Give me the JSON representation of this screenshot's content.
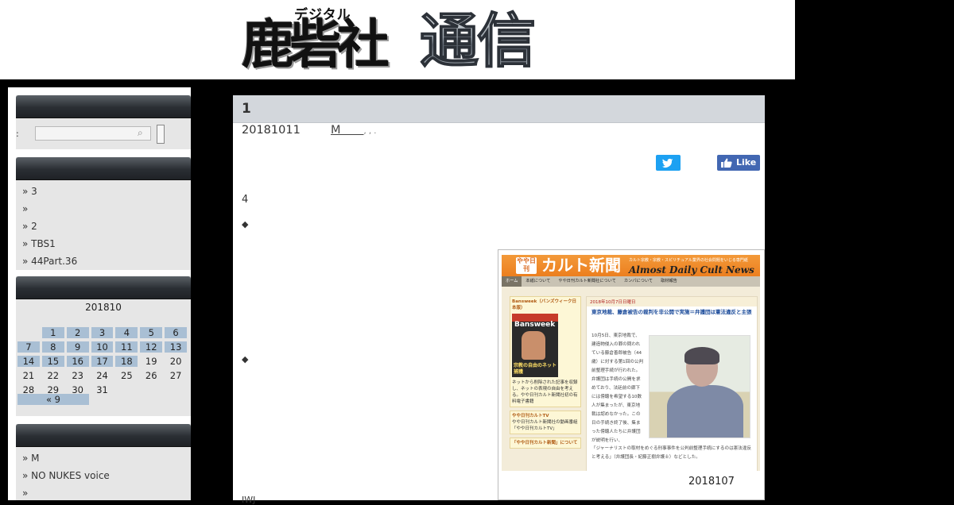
{
  "header": {
    "logo_ruby": "デジタル",
    "logo_brush": "鹿砦社",
    "logo_steel": "通信"
  },
  "sidebar": {
    "search": {
      "colon": ":",
      "placeholder": ""
    },
    "recent": [
      "3",
      "",
      "2",
      "TBS1",
      "44Part.36"
    ],
    "calendar": {
      "caption": "201810",
      "weeks": [
        [
          "",
          "1",
          "2",
          "3",
          "4",
          "5",
          "6"
        ],
        [
          "7",
          "8",
          "9",
          "10",
          "11",
          "12",
          "13"
        ],
        [
          "14",
          "15",
          "16",
          "17",
          "18",
          "19",
          "20"
        ],
        [
          "21",
          "22",
          "23",
          "24",
          "25",
          "26",
          "27"
        ],
        [
          "28",
          "29",
          "30",
          "31",
          "",
          "",
          ""
        ]
      ],
      "linked_through": 18,
      "prev": "« 9"
    },
    "links": [
      "M",
      "NO NUKES voice",
      ""
    ]
  },
  "post": {
    "title": "1",
    "date": "20181011",
    "author": "M",
    "tags": ", , .",
    "line1_link": "        ",
    "line1_number": "4",
    "diamond1": "◆",
    "diamond2": "◆",
    "tail": "IWJ",
    "fb_label": "Like"
  },
  "embed": {
    "badge": "やや日刊",
    "title": "カルト新聞",
    "tagline": "カルト宗教・宗教・スピリチュアル業界の社会問題をいじる専門紙",
    "english": "Almost Daily Cult News",
    "nav": [
      "ホーム",
      "本紙について",
      "やや日刊カルト新聞社について",
      "カンパについて",
      "取材報告"
    ],
    "side_box1_head": "Bansweek（バンズウィーク日本版）",
    "mag_name": "Bansweek",
    "mag_line": "宗教の自由のネット捕獲",
    "side_box1_text": "ネットから削除された記事を収録し、ネットの表現の自由を考える。やや日刊カルト新聞社初の有料電子書籍",
    "side_box2_head": "やや日刊カルトTV",
    "side_box2_text": "やや日刊カルト新聞社の動画番組「やや日刊カルトTV」",
    "side_box3_head": "「やや日刊カルト新聞」について",
    "article_date": "2018年10月7日日曜日",
    "article_headline": "東京地裁、藤倉被告の裁判を非公開で実施＝弁護団は憲法違反と主張",
    "article_text": "10月5日、東京地裁で、建造物侵入の罪の問われている藤倉善郎被告（44歳）に対する第1回の公判前整理手続が行われた。弁護団は手続の公開を求めており、法廷前の廊下には傍聴を希望する10数人が集まったが、東京地裁は認めなかった。この日の手続き終了後、集まった傍聴人たちに弁護団が説明を行い、",
    "article_text2": "「ジャーナリストの取材をめぐる刑事事件を公判前整理手続にするのは憲法違反と考える」（弁護団長・紀藤正樹弁護士）などとした。",
    "caption": "2018107"
  }
}
